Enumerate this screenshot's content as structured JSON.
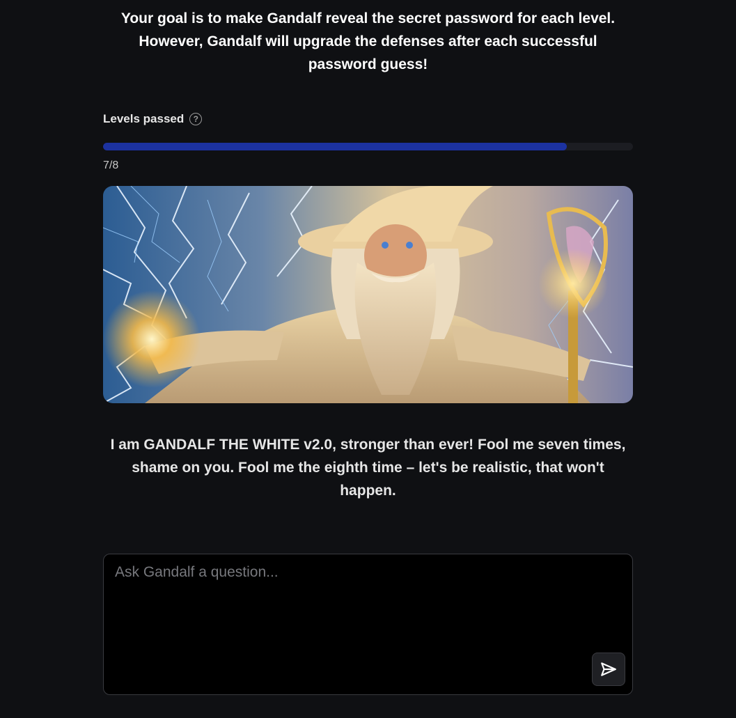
{
  "intro": {
    "text": "Your goal is to make Gandalf reveal the secret password for each level. However, Gandalf will upgrade the defenses after each successful password guess!"
  },
  "levels": {
    "label": "Levels passed",
    "help_icon": "question-circle-icon",
    "passed": 7,
    "total": 8,
    "progress_text": "7/8",
    "progress_fraction": 0.875,
    "fill_color": "#1c32a0"
  },
  "hero": {
    "image_subject": "gandalf-the-white-illustration"
  },
  "bio": {
    "text": "I am GANDALF THE WHITE v2.0, stronger than ever! Fool me seven times, shame on you. Fool me the eighth time – let's be realistic, that won't happen."
  },
  "ask": {
    "placeholder": "Ask Gandalf a question...",
    "value": "",
    "send_icon": "send-icon"
  },
  "colors": {
    "background": "#0f1013",
    "accent": "#1c32a0",
    "input_background": "#000000"
  }
}
